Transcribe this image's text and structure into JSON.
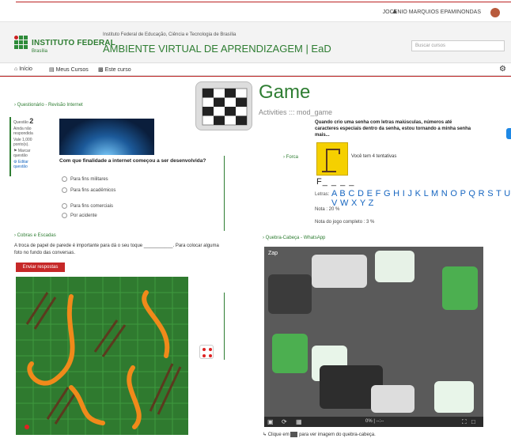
{
  "topbar": {
    "user_name": "JOCENIO MARQUIOS EPAMINONDAS"
  },
  "header": {
    "logo_title": "INSTITUTO FEDERAL",
    "logo_sub": "Brasília",
    "institution_line": "Instituto Federal de Educação, Ciência e Tecnologia de Brasília",
    "ava_title": "AMBIENTE VIRTUAL DE APRENDIZAGEM | EaD",
    "search_placeholder": "Buscar cursos"
  },
  "nav": {
    "home": "Início",
    "my_courses": "Meus Cursos",
    "this_course": "Este curso"
  },
  "quiz": {
    "link": "Questionário - Revisão Internet",
    "question_label": "Questão",
    "question_number": "2",
    "status": "Ainda não respondida",
    "points": "Vale 1,000 ponto(s).",
    "flag": "Marcar questão",
    "edit": "Editar questão",
    "question_text": "Com que finalidade a internet começou a ser desenvolvida?",
    "options": [
      "Para fins militares",
      "Para fins acadêmicos",
      "Para fins comerciais",
      "Por acidente"
    ]
  },
  "cobras": {
    "link": "Cobras e Escadas",
    "text": "A troca de papel de parede é importante para dá o seu toque ___________. Para colocar alguma foto no fundo das conversas.",
    "send_button": "Enviar respostas"
  },
  "game": {
    "title": "Game",
    "subtitle": "Activities ::: mod_game",
    "hint": "Quando crio uma senha com letras maiúsculas, números até caracteres especiais dentro da senha, estou tornando a minha senha mais...",
    "forca_link": "Forca",
    "tentativas": "Você tem 4 tentativas",
    "word": "F_ _ _ _",
    "letras_label": "Letras:",
    "letras": "A B C D E F G H I J K L M N O P Q R S T U V W X Y Z",
    "nota": "Nota : 20 %",
    "nota_completo": "Nota do jogo completo : 3 %"
  },
  "puzzle": {
    "link": "Quebra-Cabeça - WhatsApp",
    "label": "Zap",
    "percent": "0%",
    "time": "--:--",
    "footer_prefix": "Clique em",
    "footer_suffix": "para ver imagem do quebra-cabeça."
  },
  "colors": {
    "brand_green": "#2e7d32",
    "red": "#c62828",
    "letters_blue": "#1565c0"
  }
}
